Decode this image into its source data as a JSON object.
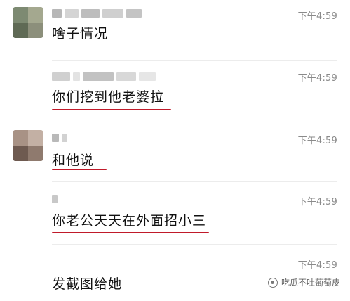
{
  "messages": [
    {
      "time": "下午4:59",
      "text": "啥子情况",
      "has_avatar": true
    },
    {
      "time": "下午4:59",
      "text": "你们挖到他老婆拉",
      "has_avatar": false
    },
    {
      "time": "下午4:59",
      "text": "和他说",
      "has_avatar": true
    },
    {
      "time": "下午4:59",
      "text": "你老公天天在外面招小三",
      "has_avatar": false
    },
    {
      "time": "下午4:59",
      "text": "发截图给她",
      "has_avatar": false
    }
  ],
  "watermark": {
    "text": "吃瓜不吐葡萄皮"
  },
  "colors": {
    "underline": "#c01a2a",
    "time": "#8a8a8a",
    "divider": "#ececec"
  },
  "icons": {
    "watermark": "wechat-channel-icon"
  }
}
